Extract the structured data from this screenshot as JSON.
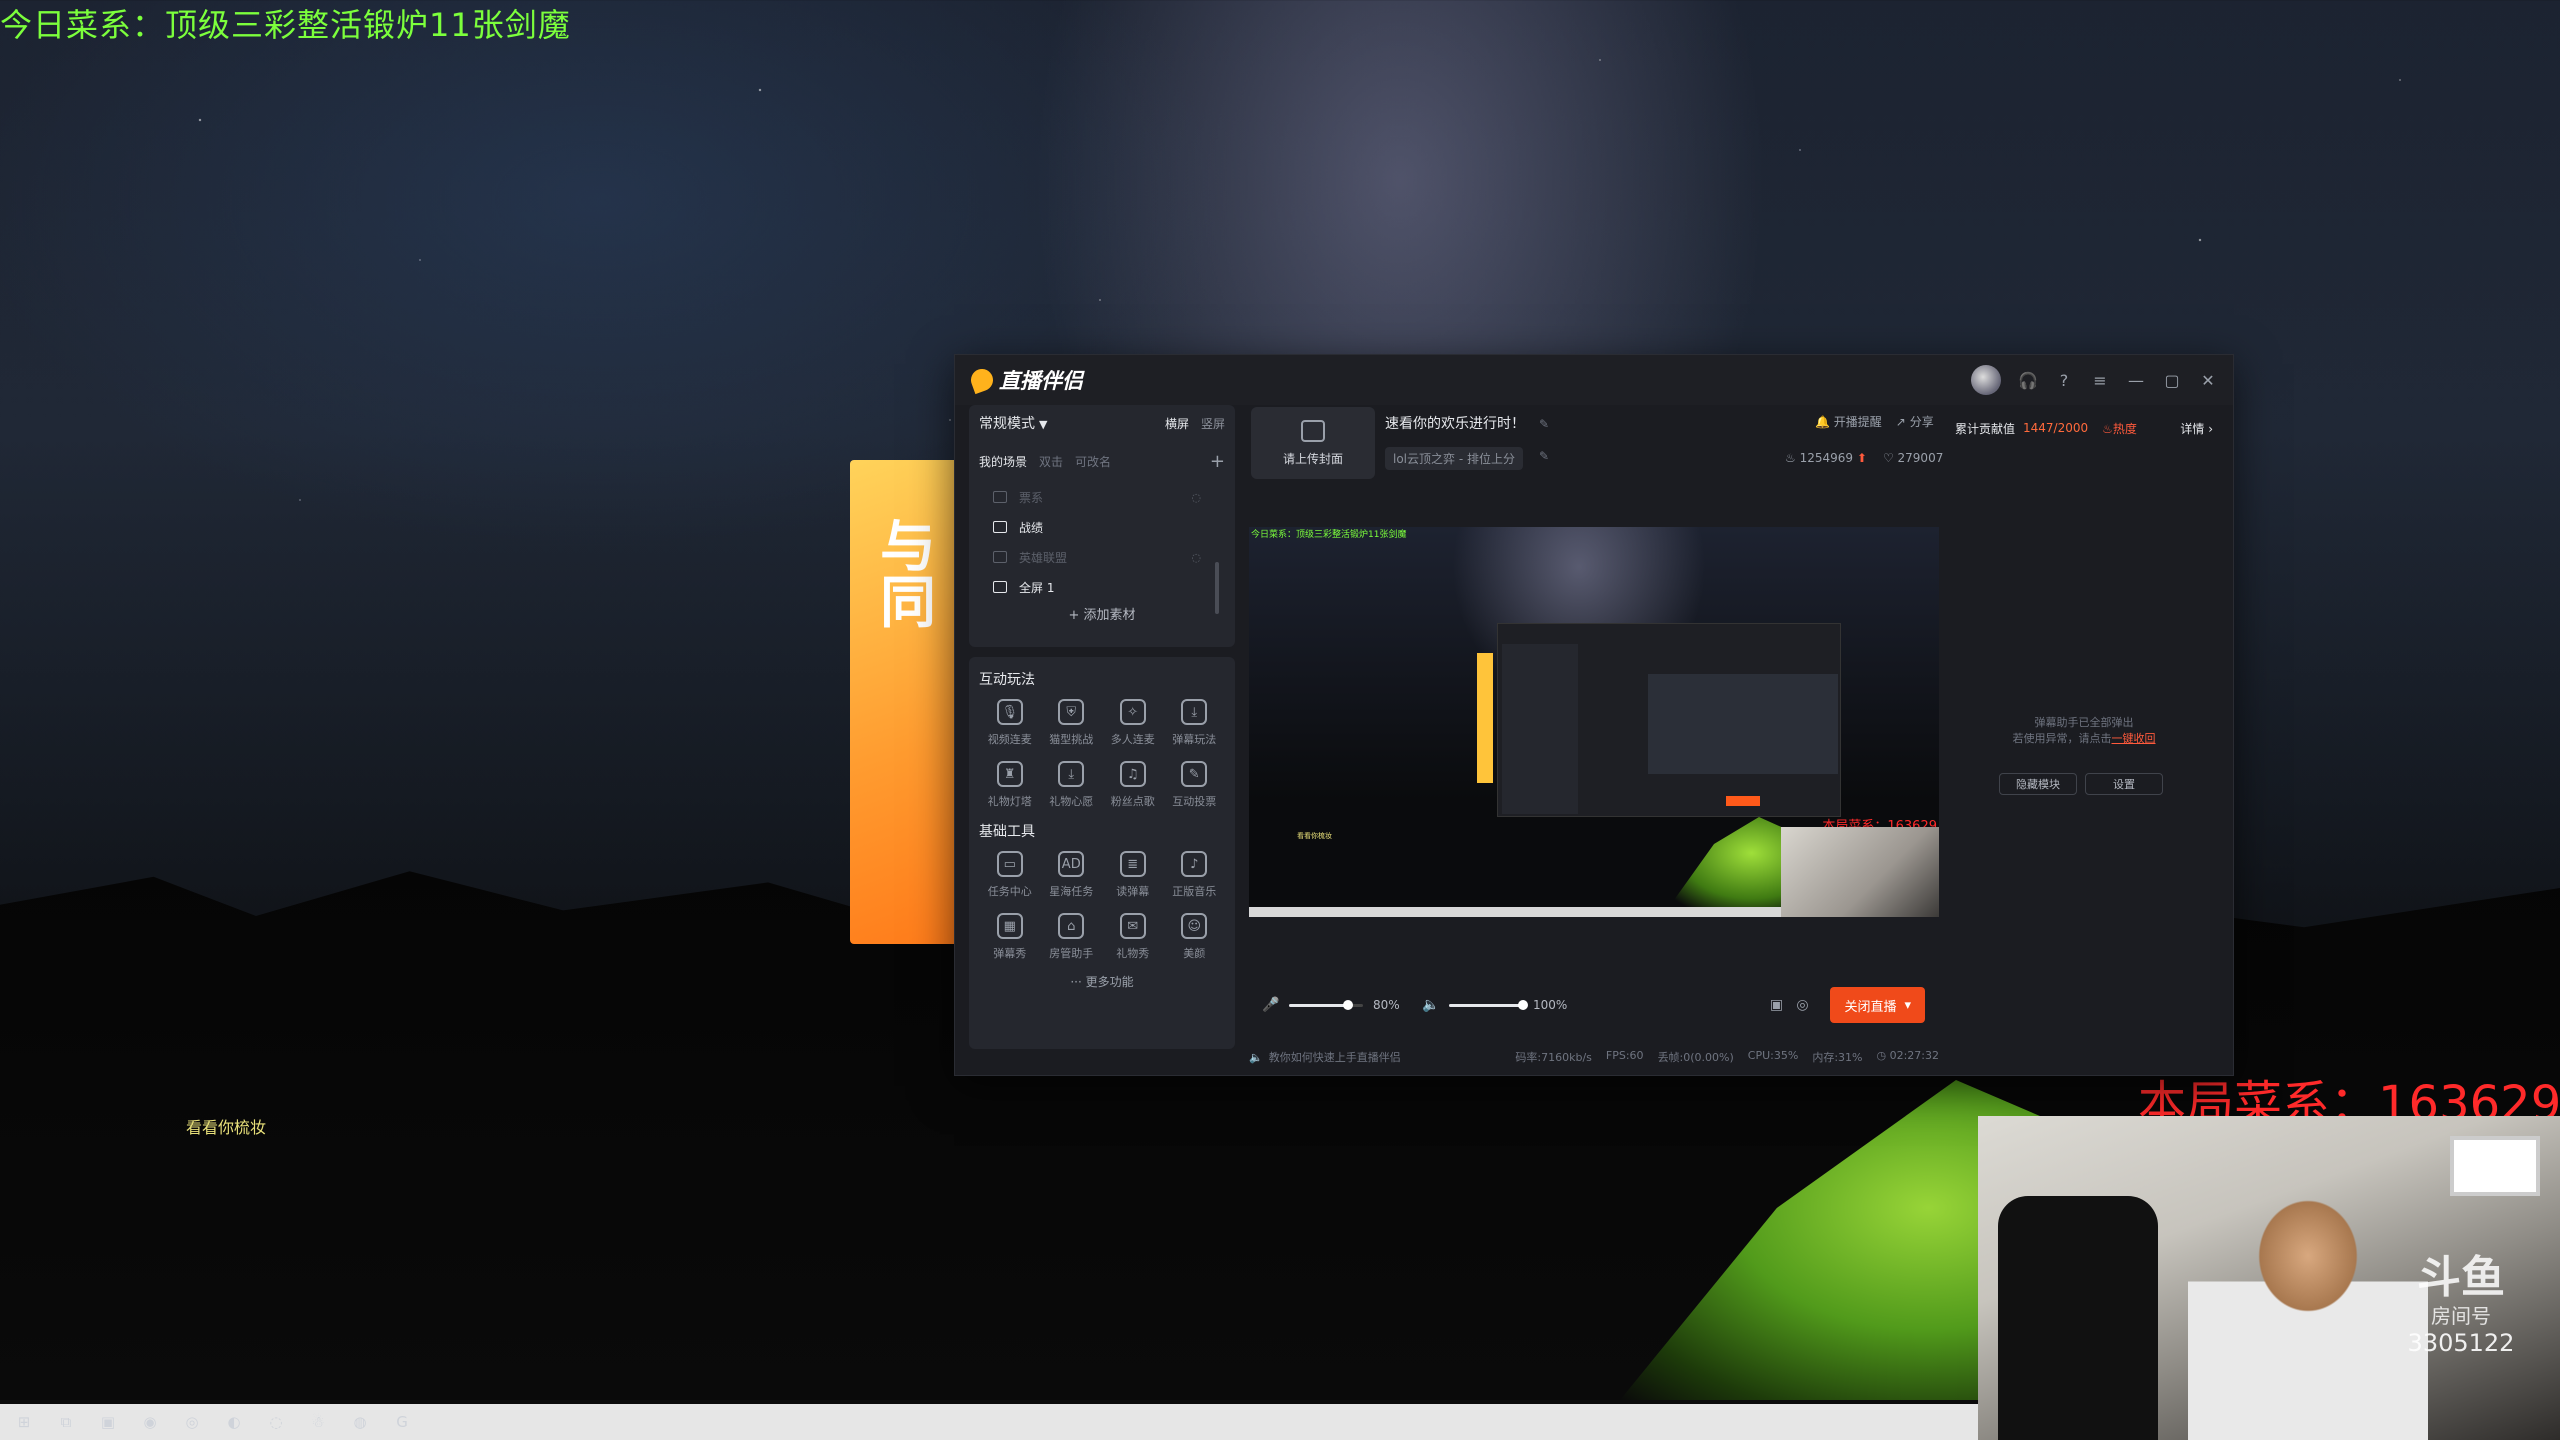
{
  "desktop": {
    "overlay_top": "今日菜系：顶级三彩整活锻炉11张剑魔",
    "overlay_score": "本局菜系：163629",
    "overlay_hint": "看看你梳妆",
    "poster_text": "与\n同"
  },
  "app": {
    "title": "直播伴侣",
    "window_controls": [
      "headset-icon",
      "help-icon",
      "menu-icon",
      "minimize-icon",
      "maximize-icon",
      "close-icon"
    ],
    "scenes": {
      "mode": "常规模式",
      "orient_landscape": "横屏",
      "orient_portrait": "竖屏",
      "tab_my": "我的场景",
      "tab_double": "双击",
      "tab_rename": "可改名",
      "items": [
        {
          "label": "票系",
          "hidden": true
        },
        {
          "label": "战绩",
          "hidden": false
        },
        {
          "label": "英雄联盟",
          "hidden": true
        },
        {
          "label": "全屏 1",
          "hidden": false
        }
      ],
      "add_material": "+ 添加素材"
    },
    "interactive": {
      "title": "互动玩法",
      "items": [
        {
          "label": "视频连麦",
          "icon": "mic-icon",
          "glyph": "🎙"
        },
        {
          "label": "猫型挑战",
          "icon": "shield-icon",
          "glyph": "⛨"
        },
        {
          "label": "多人连麦",
          "icon": "multi-mic-icon",
          "glyph": "✧"
        },
        {
          "label": "弹幕玩法",
          "icon": "download-icon",
          "glyph": "⤓"
        },
        {
          "label": "礼物灯塔",
          "icon": "lighthouse-icon",
          "glyph": "♜"
        },
        {
          "label": "礼物心愿",
          "icon": "wish-icon",
          "glyph": "⤓"
        },
        {
          "label": "粉丝点歌",
          "icon": "music-icon",
          "glyph": "♫"
        },
        {
          "label": "互动投票",
          "icon": "vote-icon",
          "glyph": "✎"
        }
      ]
    },
    "basic": {
      "title": "基础工具",
      "items": [
        {
          "label": "任务中心",
          "icon": "task-icon",
          "glyph": "▭"
        },
        {
          "label": "星海任务",
          "icon": "ad-icon",
          "glyph": "AD"
        },
        {
          "label": "读弹幕",
          "icon": "read-danmu-icon",
          "glyph": "≣"
        },
        {
          "label": "正版音乐",
          "icon": "music-note-icon",
          "glyph": "♪"
        },
        {
          "label": "弹幕秀",
          "icon": "calendar-icon",
          "glyph": "▦"
        },
        {
          "label": "房管助手",
          "icon": "home-icon",
          "glyph": "⌂"
        },
        {
          "label": "礼物秀",
          "icon": "gift-icon",
          "glyph": "✉"
        },
        {
          "label": "美颜",
          "icon": "face-icon",
          "glyph": "☺"
        }
      ],
      "more": "··· 更多功能"
    },
    "cover_label": "请上传封面",
    "room_title": "速看你的欢乐进行时！",
    "room_category": "lol云顶之弈 - 排位上分",
    "notify_label": "开播提醒",
    "share_label": "分享",
    "stat_heat": "1254969",
    "stat_likes": "279007",
    "preview": {
      "overlay_top": "今日菜系：顶级三彩整活锻炉11张剑魔",
      "overlay_score": "本局菜系：163629",
      "hint": "看看你梳妆"
    },
    "controls": {
      "mic_volume": 80,
      "mic_label": "80%",
      "speaker_volume": 100,
      "speaker_label": "100%",
      "stop_button": "关闭直播"
    },
    "footer": {
      "tip": "教你如何快速上手直播伴侣",
      "bitrate": "码率:7160kb/s",
      "fps": "FPS:60",
      "drop": "丢帧:0(0.00%)",
      "cpu": "CPU:35%",
      "mem": "内存:31%",
      "time": "02:27:32"
    },
    "contrib": {
      "label": "累计贡献值",
      "value": "1447/2000",
      "hot": "热度",
      "detail": "详情"
    },
    "danmu": {
      "line1": "弹幕助手已全部弹出",
      "line2": "若使用异常，请点击",
      "link": "一键收回",
      "hide_btn": "隐藏模块",
      "settings_btn": "设置"
    }
  },
  "webcam": {
    "badge1": "斗鱼",
    "badge2": "房间号",
    "badge3": "3305122"
  },
  "taskbar": [
    {
      "icon": "windows-icon",
      "glyph": "⊞"
    },
    {
      "icon": "task-view-icon",
      "glyph": "⧉"
    },
    {
      "icon": "photo-app-icon",
      "glyph": "▣"
    },
    {
      "icon": "live-companion-icon",
      "glyph": "◉"
    },
    {
      "icon": "obs-icon",
      "glyph": "◎"
    },
    {
      "icon": "chrome-icon",
      "glyph": "◐"
    },
    {
      "icon": "qq-browser-icon",
      "glyph": "◌"
    },
    {
      "icon": "qq-icon",
      "glyph": "☃"
    },
    {
      "icon": "netease-music-icon",
      "glyph": "◍"
    },
    {
      "icon": "game-icon",
      "glyph": "G"
    }
  ],
  "colors": {
    "accent": "#f04a1a",
    "overlay_green": "#7cff3c",
    "overlay_red": "#ff2a2a"
  }
}
